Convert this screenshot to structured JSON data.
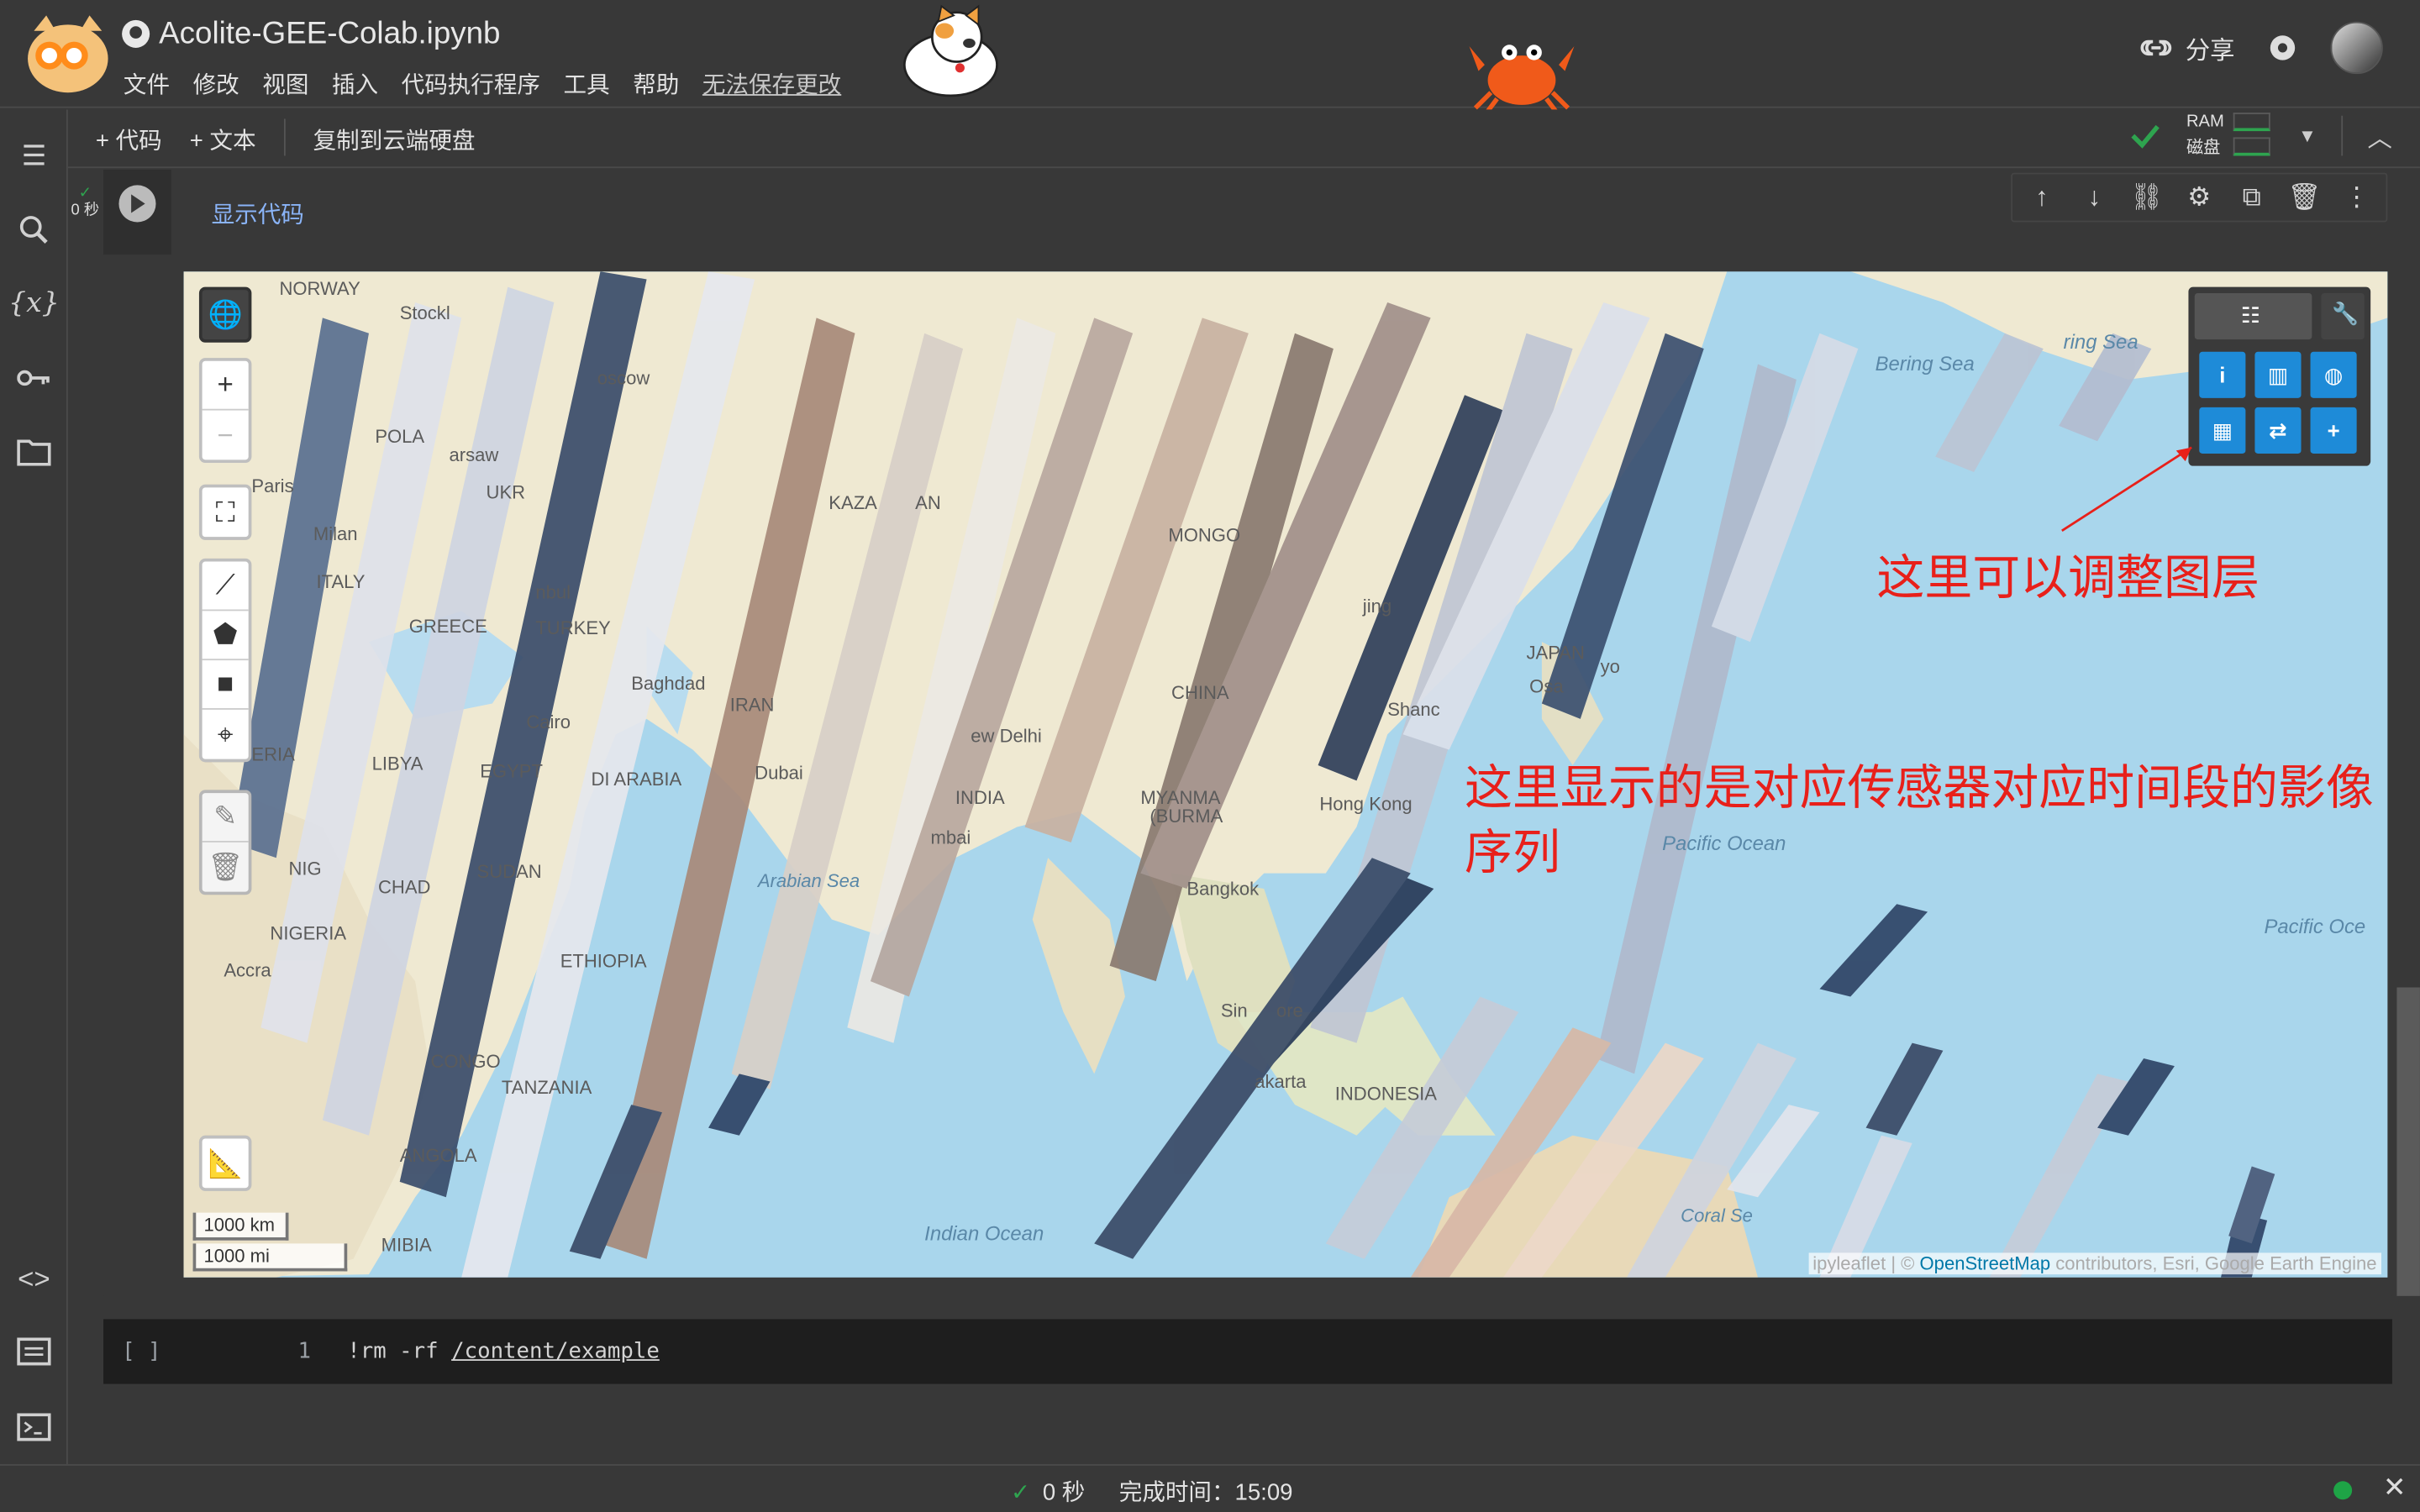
{
  "app": {
    "notebook_title": "Acolite-GEE-Colab.ipynb",
    "menu": [
      "文件",
      "修改",
      "视图",
      "插入",
      "代码执行程序",
      "工具",
      "帮助"
    ],
    "unsaved_label": "无法保存更改",
    "share_label": "分享"
  },
  "toolbar": {
    "add_code": "+ 代码",
    "add_text": "+ 文本",
    "copy_drive": "复制到云端硬盘",
    "ram_label": "RAM",
    "disk_label": "磁盘"
  },
  "sidebar": {
    "items": [
      "toc-icon",
      "search-icon",
      "variables-icon",
      "secrets-icon",
      "files-icon",
      "code-snippets-icon",
      "command-palette-icon",
      "terminal-icon"
    ]
  },
  "cell": {
    "exec_time": "0 秒",
    "show_code": "显示代码"
  },
  "map": {
    "labels": [
      "NORWAY",
      "Stockl",
      "oscow",
      "POLA",
      "arsaw",
      "UKR",
      "KAZA",
      "AN",
      "MONGO",
      "Milan",
      "ITALY",
      "Paris",
      "GREECE",
      "nbul",
      "TURKEY",
      "Baghdad",
      "IRAN",
      "Cairo",
      "LIBYA",
      "EGYPT",
      "DI ARABIA",
      "Dubai",
      "ew Delhi",
      "INDIA",
      "mbai",
      "MYANMA",
      "(BURMA",
      "Hong Kong",
      "Shanc",
      "JAPAN",
      "Osa",
      "yo",
      "jing",
      "CHINA",
      "Bering Sea",
      "ring Sea",
      "ERIA",
      "NIG",
      "CHAD",
      "SUDAN",
      "Accra",
      "NIGERIA",
      "ETHIOPIA",
      "CONGO",
      "TANZANIA",
      "ANGOLA",
      "MIBIA",
      "Bangkok",
      "Sin",
      "ore",
      "akarta",
      "INDONESIA",
      "Coral Se"
    ],
    "ocean_labels": [
      "Arabian Sea",
      "Indian Ocean",
      "Pacific Ocean",
      "Pacific Oce"
    ],
    "scale_km": "1000 km",
    "scale_mi": "1000 mi",
    "attribution_prefix": "ipyleaflet | © ",
    "attribution_link": "OpenStreetMap",
    "attribution_suffix": " contributors, Esri, Google Earth Engine"
  },
  "annotations": {
    "layers_note": "这里可以调整图层",
    "sequence_note_line1": "这里显示的是对应传感器对应时间段的影像",
    "sequence_note_line2": "序列"
  },
  "code_cell": {
    "brackets": "[ ]",
    "line_number": "1",
    "command": "!rm -rf ",
    "path": "/content/example"
  },
  "status_bar": {
    "elapsed": "0 秒",
    "completed_label": "完成时间：15:09"
  },
  "colors": {
    "annotation_red": "#e8201a",
    "link_blue": "#8ab4f8",
    "tool_blue": "#1e8bd8",
    "ok_green": "#1ea446"
  }
}
